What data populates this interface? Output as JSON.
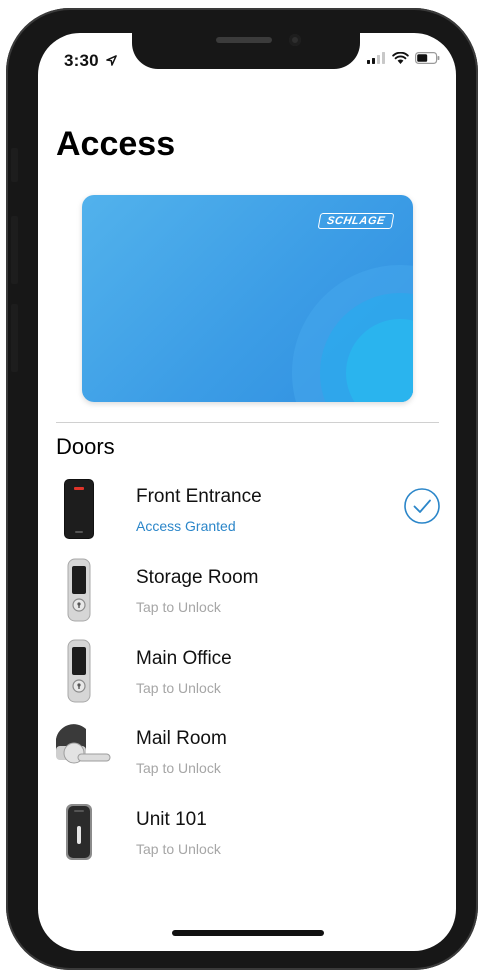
{
  "status_bar": {
    "time": "3:30"
  },
  "page": {
    "title": "Access"
  },
  "card": {
    "brand": "SCHLAGE"
  },
  "doors_section": {
    "title": "Doors"
  },
  "doors": [
    {
      "name": "Front Entrance",
      "status": "Access Granted",
      "granted": true,
      "device": "card-reader"
    },
    {
      "name": "Storage Room",
      "status": "Tap to Unlock",
      "granted": false,
      "device": "keypad-deadbolt"
    },
    {
      "name": "Main Office",
      "status": "Tap to Unlock",
      "granted": false,
      "device": "keypad-deadbolt"
    },
    {
      "name": "Mail Room",
      "status": "Tap to Unlock",
      "granted": false,
      "device": "lever-lock"
    },
    {
      "name": "Unit 101",
      "status": "Tap to Unlock",
      "granted": false,
      "device": "smart-deadbolt"
    }
  ],
  "colors": {
    "accent": "#2b86c9",
    "card": "#3c9de6",
    "muted": "#a6a6a6"
  }
}
